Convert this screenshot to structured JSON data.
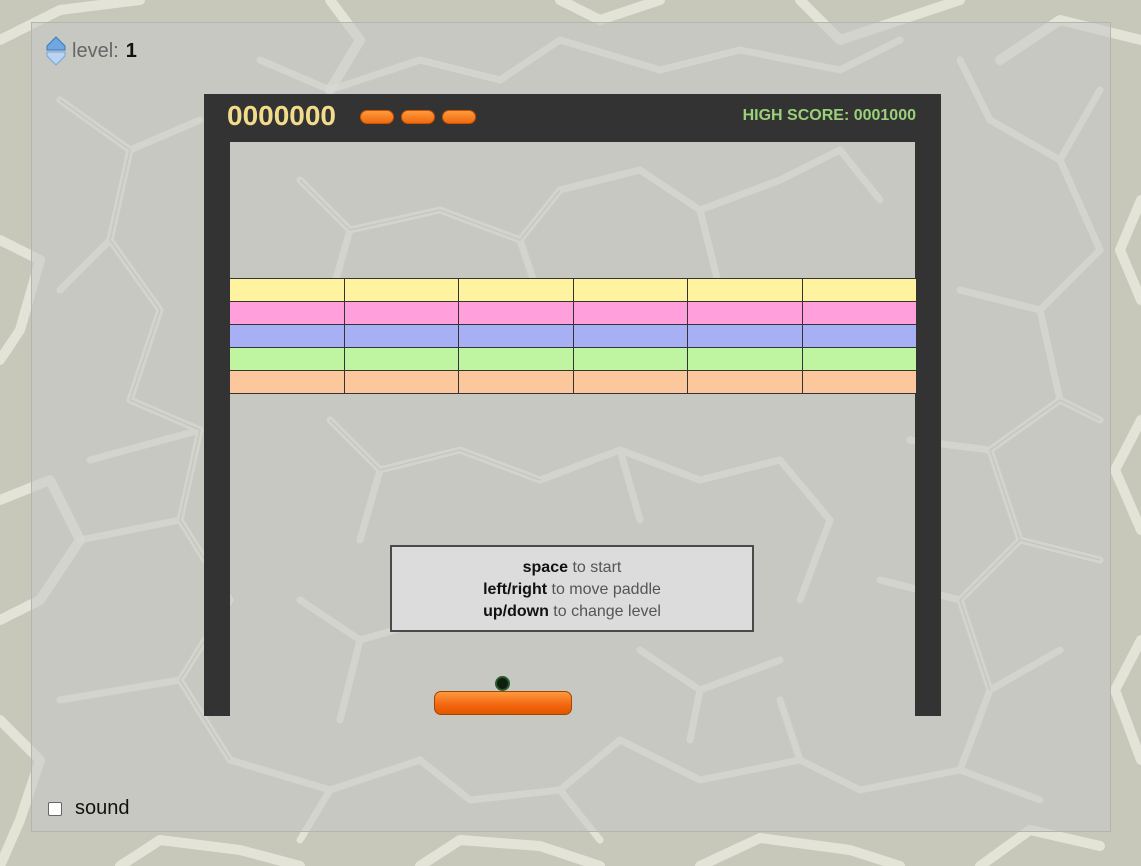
{
  "level": {
    "label": "level:",
    "value": "1",
    "icon": "level-arrows-icon"
  },
  "hud": {
    "score": "0000000",
    "lives": 3,
    "high_score": "HIGH SCORE: 0001000"
  },
  "bricks": {
    "columns": 6,
    "row_colors": [
      "#fff3a0",
      "#ffa0dd",
      "#a7b0f5",
      "#bff5a0",
      "#fdc79e"
    ]
  },
  "instructions": [
    {
      "key": "space",
      "text": " to start"
    },
    {
      "key": "left/right",
      "text": " to move paddle"
    },
    {
      "key": "up/down",
      "text": " to change level"
    }
  ],
  "sound": {
    "label": "sound",
    "checked": false
  },
  "colors": {
    "frame": "#333333",
    "score": "#f2dc8c",
    "high_score": "#9ad07a",
    "paddle": "#f2650e"
  }
}
